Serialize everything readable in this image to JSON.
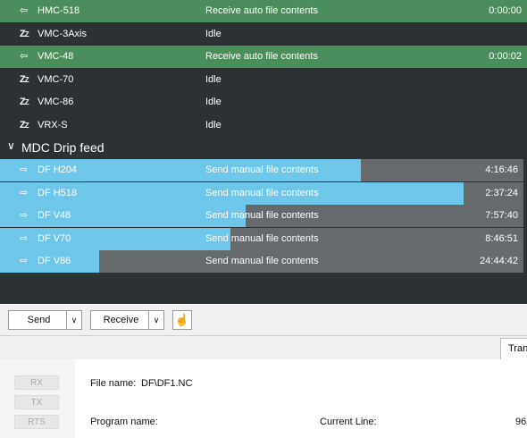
{
  "machines": [
    {
      "icon": "arrow-left-icon",
      "name": "HMC-518",
      "status": "Receive auto file contents",
      "time": "0:00:00",
      "active": true
    },
    {
      "icon": "idle-zz-icon",
      "name": "VMC-3Axis",
      "status": "Idle",
      "time": "",
      "active": false
    },
    {
      "icon": "arrow-left-icon",
      "name": "VMC-48",
      "status": "Receive auto file contents",
      "time": "0:00:02",
      "active": true
    },
    {
      "icon": "idle-zz-icon",
      "name": "VMC-70",
      "status": "Idle",
      "time": "",
      "active": false
    },
    {
      "icon": "idle-zz-icon",
      "name": "VMC-86",
      "status": "Idle",
      "time": "",
      "active": false
    },
    {
      "icon": "idle-zz-icon",
      "name": "VRX-S",
      "status": "Idle",
      "time": "",
      "active": false
    }
  ],
  "group": {
    "title": "MDC Drip feed",
    "chevron": "∨"
  },
  "drip_feeds": [
    {
      "icon": "arrow-right-icon",
      "name": "DF H204",
      "status": "Send manual file contents",
      "time": "4:16:46",
      "progress": 0.69
    },
    {
      "icon": "arrow-right-icon",
      "name": "DF H518",
      "status": "Send manual file contents",
      "time": "2:37:24",
      "progress": 0.885
    },
    {
      "icon": "arrow-right-icon",
      "name": "DF V48",
      "status": "Send manual file contents",
      "time": "7:57:40",
      "progress": 0.47
    },
    {
      "icon": "arrow-right-icon",
      "name": "DF V70",
      "status": "Send manual file contents",
      "time": "8:46:51",
      "progress": 0.44
    },
    {
      "icon": "arrow-right-icon",
      "name": "DF V86",
      "status": "Send manual file contents",
      "time": "24:44:42",
      "progress": 0.19
    }
  ],
  "toolbar": {
    "send_label": "Send",
    "receive_label": "Receive",
    "dropdown_glyph": "∨",
    "hand_glyph": "☝"
  },
  "tabs": {
    "active_tab_partial": "Tran"
  },
  "sidebar": {
    "rx": "RX",
    "tx": "TX",
    "rts": "RTS"
  },
  "details": {
    "file_name_label": "File name:",
    "file_name_value": "DF\\DF1.NC",
    "program_name_label": "Program name:",
    "current_line_label": "Current Line:",
    "current_line_value_partial": "96"
  },
  "colors": {
    "list_bg": "#2c3134",
    "active_row": "#4a8f5b",
    "progress_fill": "#6ec6ea",
    "progress_track": "#666a6d"
  }
}
